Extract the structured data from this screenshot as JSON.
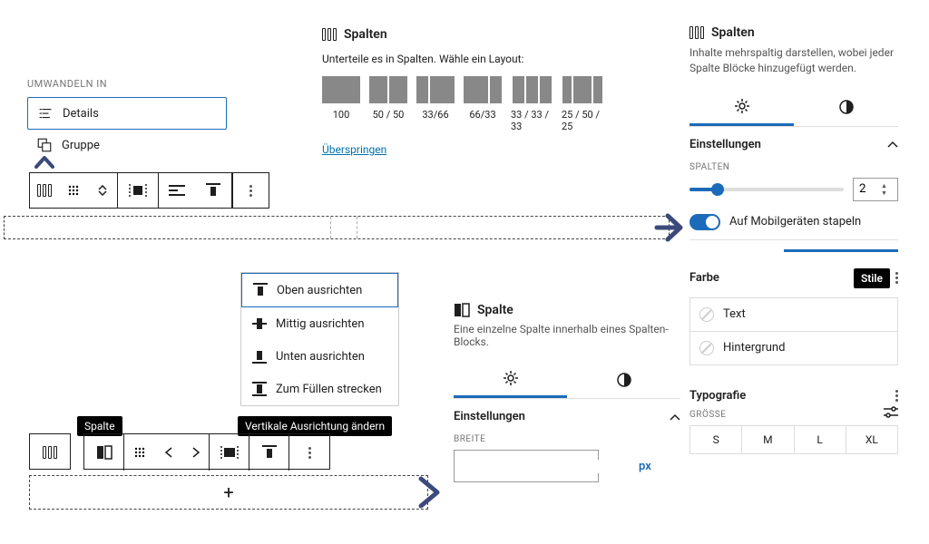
{
  "transform": {
    "heading": "Umwandeln in",
    "items": [
      "Details",
      "Gruppe"
    ]
  },
  "layout_chooser": {
    "title": "Spalten",
    "subtitle": "Unterteile es in Spalten. Wähle ein Layout:",
    "options": [
      {
        "label": "100",
        "cols": [
          42
        ]
      },
      {
        "label": "50 / 50",
        "cols": [
          20,
          20
        ]
      },
      {
        "label": "33/66",
        "cols": [
          13,
          27
        ]
      },
      {
        "label": "66/33",
        "cols": [
          27,
          13
        ]
      },
      {
        "label": "33 / 33 / 33",
        "cols": [
          13,
          13,
          13
        ]
      },
      {
        "label": "25 / 50 / 25",
        "cols": [
          10,
          20,
          10
        ]
      }
    ],
    "skip": "Überspringen"
  },
  "valign": {
    "items": [
      "Oben ausrichten",
      "Mittig ausrichten",
      "Unten ausrichten",
      "Zum Füllen strecken"
    ]
  },
  "tooltips": {
    "spalte": "Spalte",
    "valign": "Vertikale Ausrichtung ändern"
  },
  "spalte_panel": {
    "title": "Spalte",
    "desc": "Eine einzelne Spalte innerhalb eines Spalten-Blocks.",
    "settings": "Einstellungen",
    "breite": "Breite",
    "unit": "px"
  },
  "spalten_panel": {
    "title": "Spalten",
    "desc": "Inhalte mehrspaltig darstellen, wobei jeder Spalte Blöcke hinzugefügt werden.",
    "settings": "Einstellungen",
    "spalten_label": "Spalten",
    "columns_value": "2",
    "stack_label": "Auf Mobilgeräten stapeln",
    "farbe": "Farbe",
    "stile_chip": "Stile",
    "color_text": "Text",
    "color_bg": "Hintergrund",
    "typografie": "Typografie",
    "groesse": "Grösse",
    "sizes": [
      "S",
      "M",
      "L",
      "XL"
    ]
  }
}
